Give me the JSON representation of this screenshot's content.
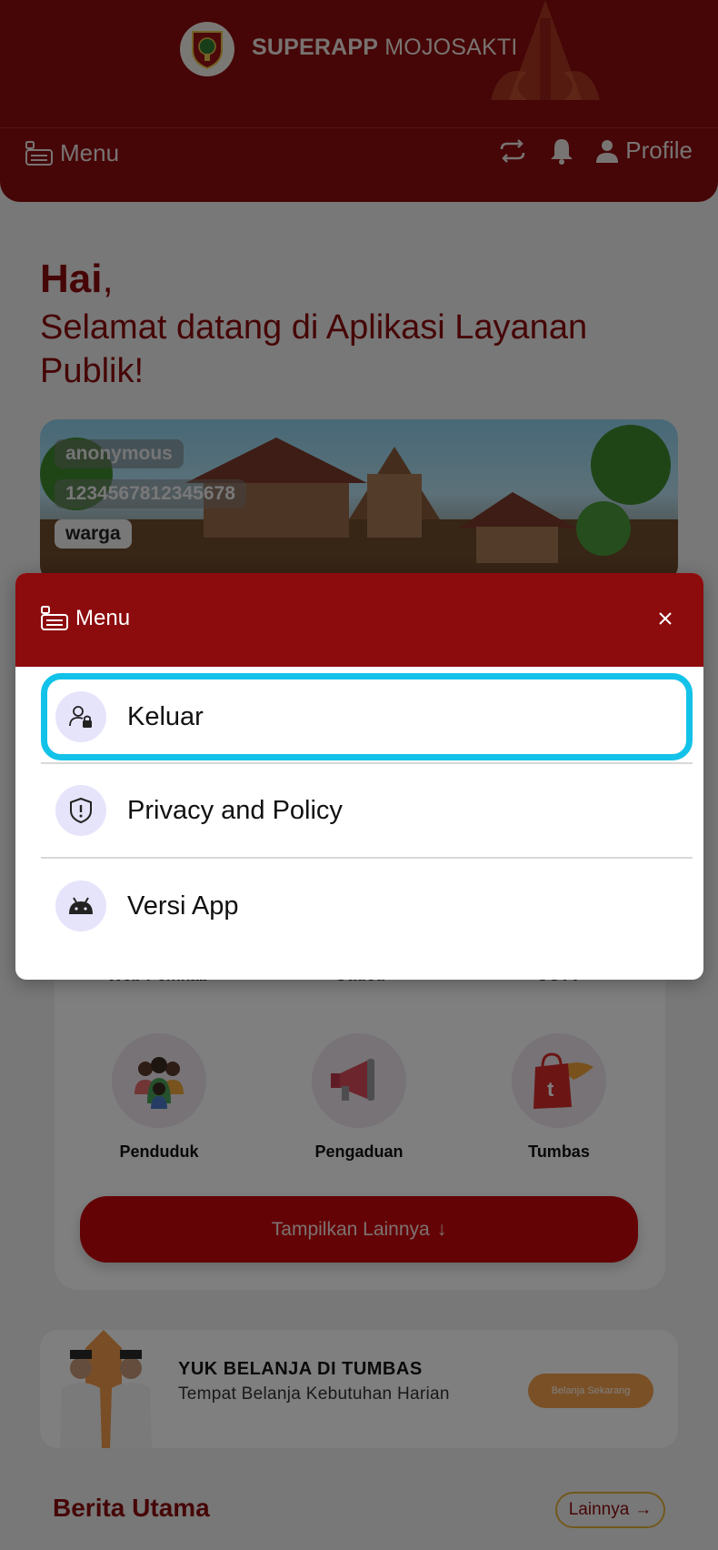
{
  "header": {
    "app_title_bold": "SUPERAPP",
    "app_title_rest": " MOJOSAKTI",
    "menu_label": "Menu",
    "profile_label": "Profile"
  },
  "greeting": {
    "hai": "Hai",
    "comma": ",",
    "subtitle": "Selamat datang di Aplikasi Layanan Publik!"
  },
  "user_card": {
    "name": "anonymous",
    "id": "1234567812345678",
    "role": "warga"
  },
  "services": {
    "partial_labels": [
      "Web Pemkab",
      "Gadeu",
      "CCTV"
    ],
    "items": [
      {
        "label": "Penduduk",
        "icon": "people-icon"
      },
      {
        "label": "Pengaduan",
        "icon": "megaphone-icon"
      },
      {
        "label": "Tumbas",
        "icon": "shopping-bag-icon"
      }
    ],
    "show_more": "Tampilkan Lainnya",
    "show_more_arrow": "↓"
  },
  "promo": {
    "title": "YUK BELANJA DI TUMBAS",
    "subtitle": "Tempat Belanja Kebutuhan Harian",
    "button": "Belanja Sekarang"
  },
  "news": {
    "title": "Berita Utama",
    "more": "Lainnya",
    "more_arrow": "→"
  },
  "menu_modal": {
    "title": "Menu",
    "items": [
      {
        "label": "Keluar",
        "icon": "user-lock-icon"
      },
      {
        "label": "Privacy and Policy",
        "icon": "shield-alert-icon"
      },
      {
        "label": "Versi App",
        "icon": "android-icon"
      }
    ]
  },
  "colors": {
    "brand": "#8c0b0d",
    "button_red": "#c9060b",
    "highlight": "#13c2e9",
    "promo_button": "#f5a04e"
  }
}
